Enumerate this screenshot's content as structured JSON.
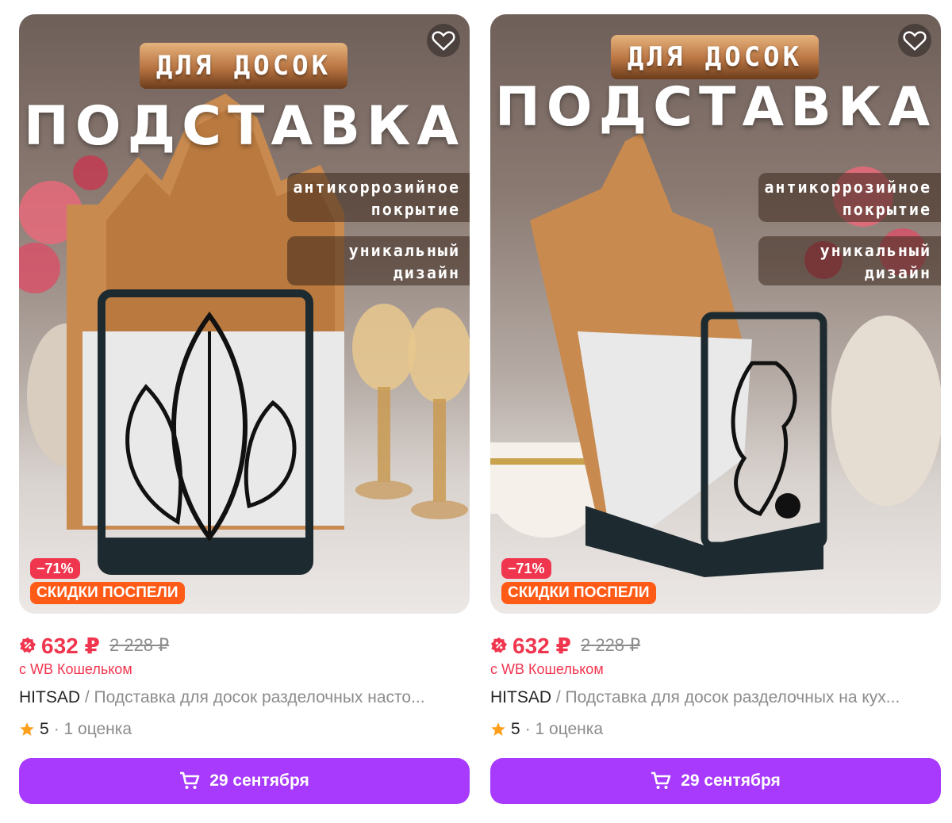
{
  "cards": [
    {
      "photo": {
        "top_label": "ДЛЯ ДОСОК",
        "headline": "ПОДСТАВКА",
        "features": [
          {
            "line1": "антикоррозийное",
            "line2": "покрытие"
          },
          {
            "line1": "уникальный",
            "line2": "дизайн"
          }
        ],
        "discount": "−71%",
        "promo": "СКИДКИ ПОСПЕЛИ"
      },
      "price": "632 ₽",
      "old_price": "2 228 ₽",
      "wallet_note": "с WB Кошельком",
      "brand": "HITSAD",
      "separator": " / ",
      "name": "Подставка для досок разделочных насто...",
      "rating": "5",
      "rating_count": "· 1 оценка",
      "delivery": "29 сентября"
    },
    {
      "photo": {
        "top_label": "ДЛЯ ДОСОК",
        "headline": "ПОДСТАВКА",
        "features": [
          {
            "line1": "антикоррозийное",
            "line2": "покрытие"
          },
          {
            "line1": "уникальный",
            "line2": "дизайн"
          }
        ],
        "discount": "−71%",
        "promo": "СКИДКИ ПОСПЕЛИ"
      },
      "price": "632 ₽",
      "old_price": "2 228 ₽",
      "wallet_note": "с WB Кошельком",
      "brand": "HITSAD",
      "separator": " / ",
      "name": "Подставка для досок разделочных на кух...",
      "rating": "5",
      "rating_count": "· 1 оценка",
      "delivery": "29 сентября"
    }
  ],
  "colors": {
    "price_red": "#f0364f",
    "promo_orange": "#ff5a16",
    "button_purple": "#a73afd",
    "star_orange": "#ff9f1c"
  },
  "icons": {
    "wishlist": "heart-icon",
    "price": "discount-badge-icon",
    "rating": "star-icon",
    "button": "cart-icon"
  }
}
